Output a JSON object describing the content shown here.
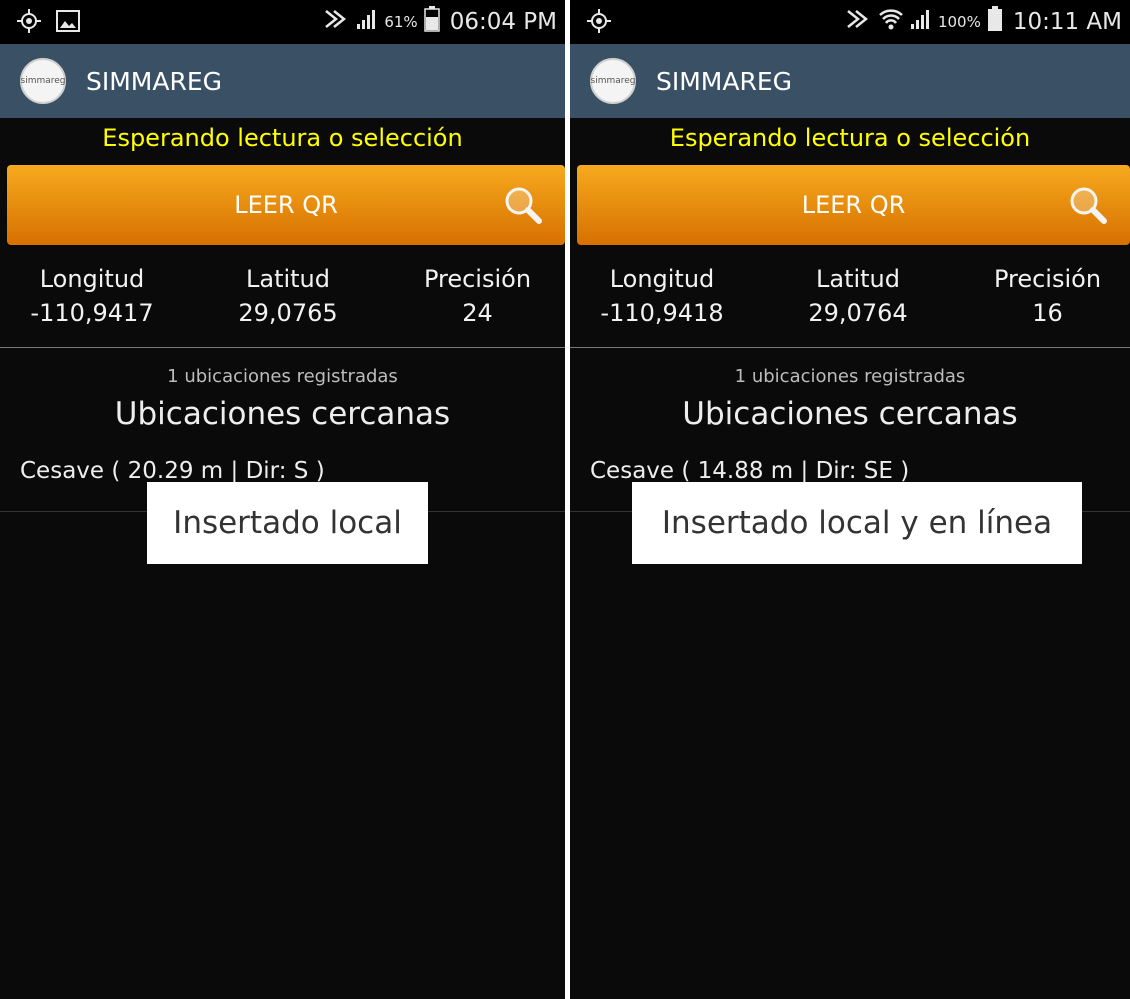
{
  "screens": [
    {
      "status_bar": {
        "left_icons": [
          "gps-icon",
          "image-icon"
        ],
        "right_icons": [
          "mute-icon",
          "signal-icon",
          "battery-icon"
        ],
        "battery": "61%",
        "time": "06:04 PM"
      },
      "app": {
        "title": "SIMMAREG",
        "logo_text": "simmareg"
      },
      "status_message": "Esperando lectura o selección",
      "read_button": "LEER QR",
      "coords": {
        "longitude_label": "Longitud",
        "longitude": "-110,9417",
        "latitude_label": "Latitud",
        "latitude": "29,0765",
        "precision_label": "Precisión",
        "precision": "24"
      },
      "registered_count": "1 ubicaciones registradas",
      "nearby_title": "Ubicaciones cercanas",
      "nearby_items": [
        "Cesave ( 20.29 m | Dir: S )"
      ],
      "toast": "Insertado local"
    },
    {
      "status_bar": {
        "left_icons": [
          "gps-icon"
        ],
        "right_icons": [
          "mute-icon",
          "wifi-icon",
          "signal-icon",
          "battery-icon"
        ],
        "battery": "100%",
        "time": "10:11 AM"
      },
      "app": {
        "title": "SIMMAREG",
        "logo_text": "simmareg"
      },
      "status_message": "Esperando lectura o selección",
      "read_button": "LEER QR",
      "coords": {
        "longitude_label": "Longitud",
        "longitude": "-110,9418",
        "latitude_label": "Latitud",
        "latitude": "29,0764",
        "precision_label": "Precisión",
        "precision": "16"
      },
      "registered_count": "1 ubicaciones registradas",
      "nearby_title": "Ubicaciones cercanas",
      "nearby_items": [
        "Cesave ( 14.88 m | Dir: SE )"
      ],
      "toast": "Insertado local y en línea"
    }
  ],
  "colors": {
    "app_bar": "#3a5165",
    "status_message": "#ffff00",
    "button_top": "#f6aa1e",
    "button_bottom": "#d77000",
    "background": "#0a0a0a"
  }
}
